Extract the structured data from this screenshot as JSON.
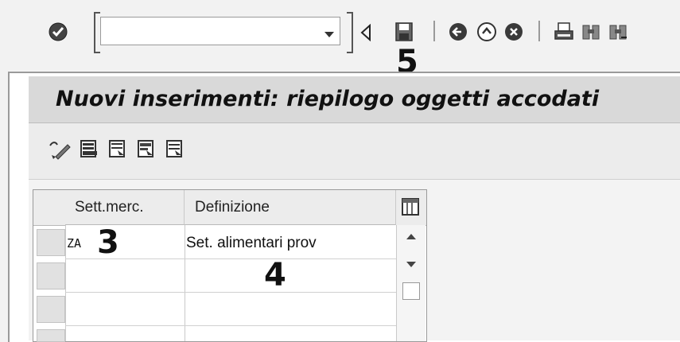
{
  "toolbar": {
    "command_field": {
      "value": "",
      "placeholder": ""
    },
    "icons": [
      "enter-check-icon",
      "dropdown-chevron-icon",
      "collapse-triangle-icon",
      "save-icon",
      "back-icon",
      "exit-icon",
      "cancel-icon",
      "print-icon",
      "find-icon",
      "find-next-icon"
    ]
  },
  "annotations": {
    "n3": "3",
    "n4": "4",
    "n5": "5"
  },
  "screen": {
    "title": "Nuovi inserimenti: riepilogo oggetti accodati"
  },
  "app_toolbar": {
    "icons": [
      "change-display-icon",
      "select-all-icon",
      "select-block-icon",
      "deselect-all-icon",
      "details-icon"
    ]
  },
  "table": {
    "columns": [
      "Sett.merc.",
      "Definizione"
    ],
    "rows": [
      {
        "code": "ZA",
        "definition": "Set. alimentari prov"
      },
      {
        "code": "",
        "definition": ""
      },
      {
        "code": "",
        "definition": ""
      },
      {
        "code": "",
        "definition": ""
      }
    ]
  }
}
